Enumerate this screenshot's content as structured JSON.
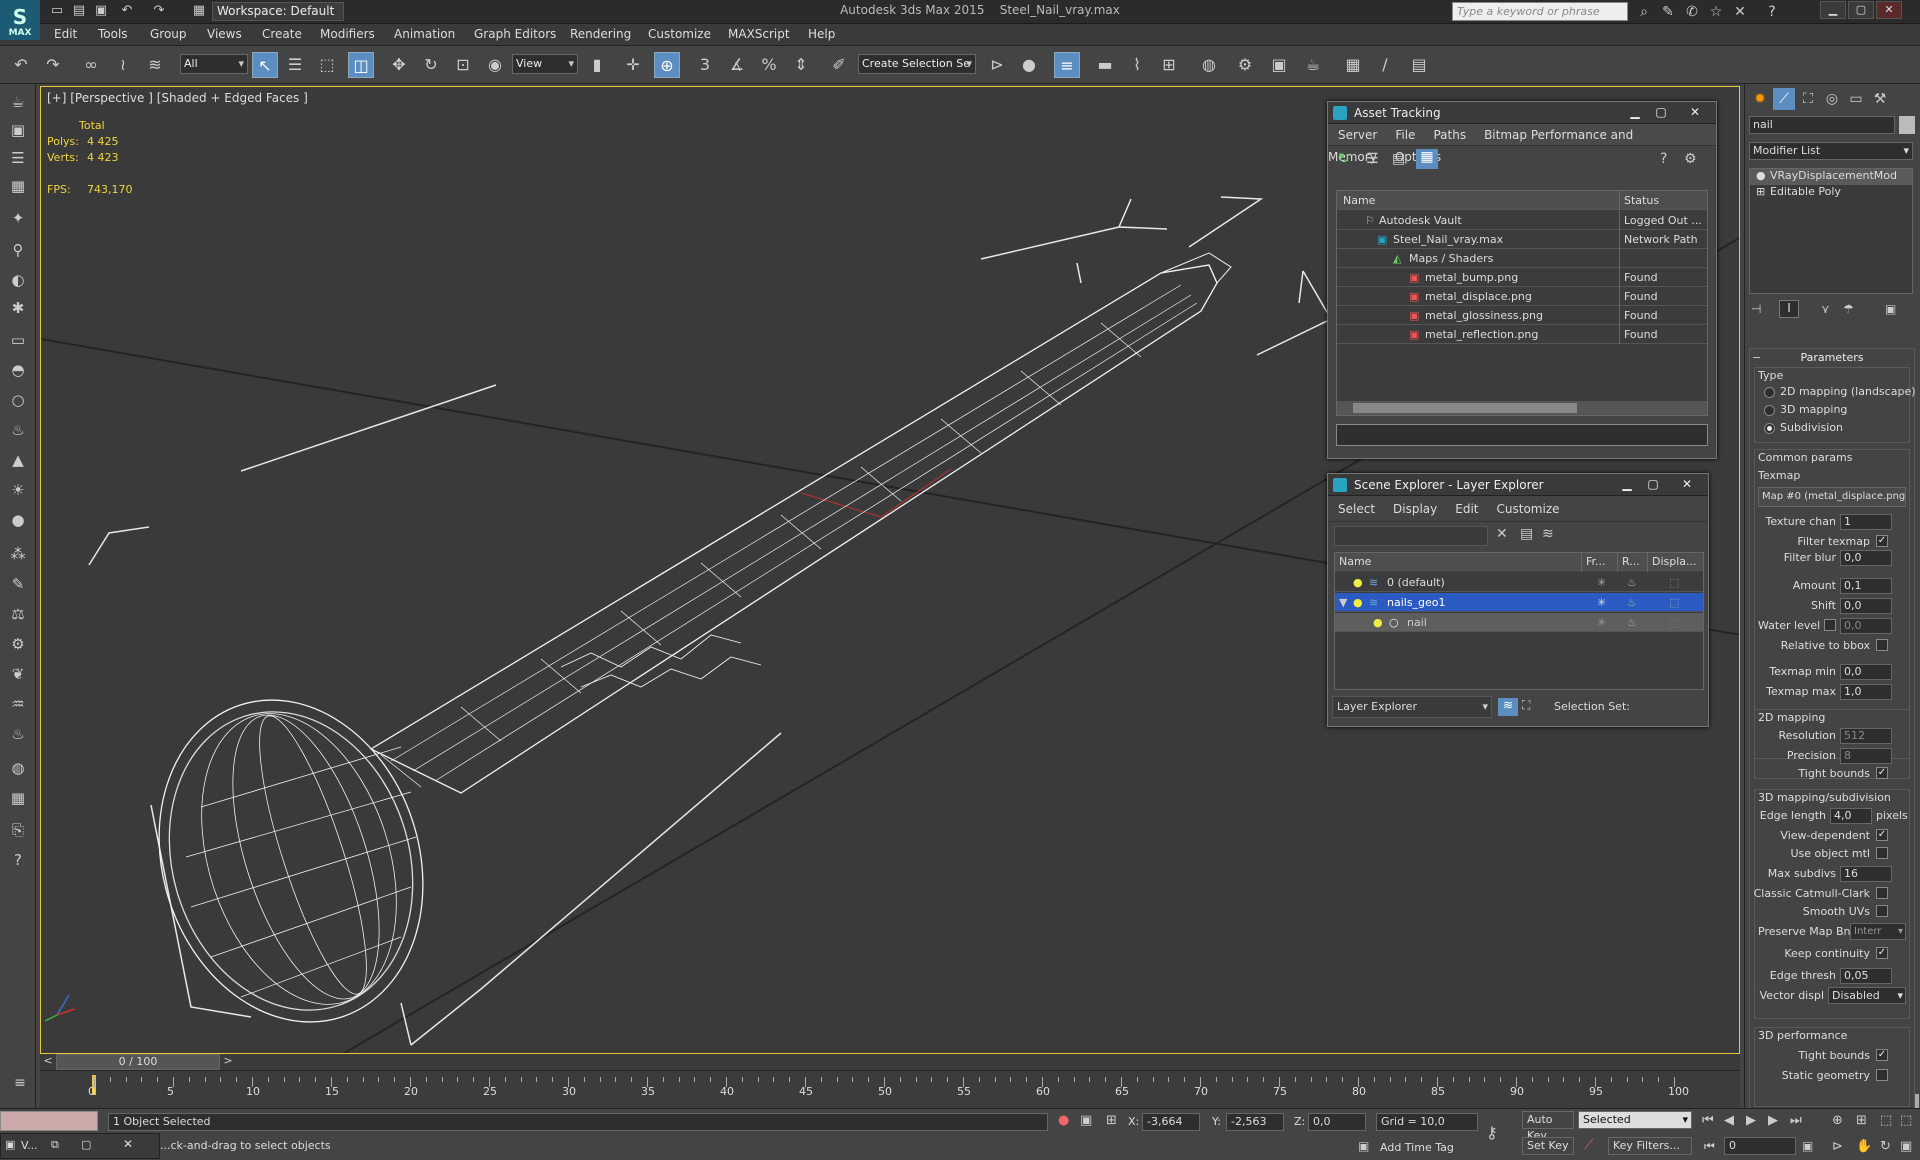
{
  "app": {
    "title": "Autodesk 3ds Max 2015",
    "file": "Steel_Nail_vray.max",
    "logo": "MAX",
    "workspace": "Workspace: Default",
    "search_placeholder": "Type a keyword or phrase"
  },
  "menu": [
    "Edit",
    "Tools",
    "Group",
    "Views",
    "Create",
    "Modifiers",
    "Animation",
    "Graph Editors",
    "Rendering",
    "Customize",
    "MAXScript",
    "Help"
  ],
  "toolbar": {
    "selection_filter": "All",
    "ref_coord": "View",
    "named_selection": "Create Selection Se"
  },
  "viewport": {
    "label": "[+] [Perspective ] [Shaded + Edged Faces ]",
    "stats": {
      "total_label": "Total",
      "polys_label": "Polys:",
      "polys": "4 425",
      "verts_label": "Verts:",
      "verts": "4 423",
      "fps_label": "FPS:",
      "fps": "743,170"
    }
  },
  "asset_tracking": {
    "title": "Asset Tracking",
    "menu": [
      "Server",
      "File",
      "Paths",
      "Bitmap Performance and Memory",
      "Options"
    ],
    "col_name": "Name",
    "col_status": "Status",
    "rows": [
      {
        "name": "Autodesk Vault",
        "status": "Logged Out ..."
      },
      {
        "name": "Steel_Nail_vray.max",
        "status": "Network Path"
      },
      {
        "name": "Maps / Shaders",
        "status": ""
      },
      {
        "name": "metal_bump.png",
        "status": "Found"
      },
      {
        "name": "metal_displace.png",
        "status": "Found"
      },
      {
        "name": "metal_glossiness.png",
        "status": "Found"
      },
      {
        "name": "metal_reflection.png",
        "status": "Found"
      }
    ]
  },
  "scene_explorer": {
    "title": "Scene Explorer - Layer Explorer",
    "menu": [
      "Select",
      "Display",
      "Edit",
      "Customize"
    ],
    "col_name": "Name",
    "col_freeze": "Fr...",
    "col_render": "R...",
    "col_display": "Displa...",
    "rows": [
      {
        "name": "0 (default)"
      },
      {
        "name": "nails_geo1"
      },
      {
        "name": "nail"
      }
    ],
    "footer_mode": "Layer Explorer",
    "selection_set_label": "Selection Set:"
  },
  "command_panel": {
    "object_name": "nail",
    "modifier_list": "Modifier List",
    "stack": [
      "VRayDisplacementMod",
      "Editable Poly"
    ],
    "parameters_title": "Parameters",
    "type_label": "Type",
    "type_options": [
      "2D mapping (landscape)",
      "3D mapping",
      "Subdivision"
    ],
    "common_params": "Common params",
    "texmap_label": "Texmap",
    "texmap_value": "Map #0 (metal_displace.png)",
    "texture_chan_label": "Texture chan",
    "texture_chan": "1",
    "filter_texmap_label": "Filter texmap",
    "filter_blur_label": "Filter blur",
    "filter_blur": "0,0",
    "amount_label": "Amount",
    "amount": "0,1",
    "shift_label": "Shift",
    "shift": "0,0",
    "water_level_label": "Water level",
    "water_level": "0,0",
    "relative_bbox_label": "Relative to bbox",
    "texmap_min_label": "Texmap min",
    "texmap_min": "0,0",
    "texmap_max_label": "Texmap max",
    "texmap_max": "1,0",
    "mapping2d_title": "2D mapping",
    "resolution_label": "Resolution",
    "resolution": "512",
    "precision_label": "Precision",
    "precision": "8",
    "tight_bounds_label": "Tight bounds",
    "mapping3d_title": "3D mapping/subdivision",
    "edge_length_label": "Edge length",
    "edge_length": "4,0",
    "pixels_label": "pixels",
    "view_dependent_label": "View-dependent",
    "use_object_mtl_label": "Use object mtl",
    "max_subdivs_label": "Max subdivs",
    "max_subdivs": "16",
    "catmull_label": "Classic Catmull-Clark",
    "smooth_uvs_label": "Smooth UVs",
    "preserve_map_label": "Preserve Map Bnd",
    "preserve_map": "Interr",
    "keep_continuity_label": "Keep continuity",
    "edge_thresh_label": "Edge thresh",
    "edge_thresh": "0,05",
    "vector_displ_label": "Vector displ",
    "vector_displ": "Disabled",
    "perf_title": "3D performance",
    "tight_bounds2_label": "Tight bounds",
    "static_geometry_label": "Static geometry"
  },
  "timeline": {
    "frame_counter": "0 / 100",
    "ticks": [
      "0",
      "5",
      "10",
      "15",
      "20",
      "25",
      "30",
      "35",
      "40",
      "45",
      "50",
      "55",
      "60",
      "65",
      "70",
      "75",
      "80",
      "85",
      "90",
      "95",
      "100"
    ]
  },
  "statusbar": {
    "mini_listener": "V...",
    "selected_text": "1 Object Selected",
    "prompt": "...ck-and-drag to select objects",
    "x_label": "X:",
    "x": "-3,664",
    "y_label": "Y:",
    "y": "-2,563",
    "z_label": "Z:",
    "z": "0,0",
    "grid": "Grid = 10,0",
    "add_time_tag": "Add Time Tag",
    "auto_key": "Auto Key",
    "set_key": "Set Key",
    "selected_dd": "Selected",
    "key_filters": "Key Filters...",
    "current_frame": "0"
  }
}
